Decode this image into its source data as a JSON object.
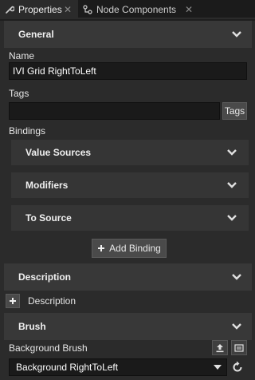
{
  "tabs": [
    {
      "label": "Properties",
      "icon": "wrench-icon",
      "active": true
    },
    {
      "label": "Node Components",
      "icon": "components-icon",
      "active": false
    }
  ],
  "tab_close_glyph": "✕",
  "general": {
    "title": "General",
    "name_label": "Name",
    "name_value": "IVI Grid RightToLeft",
    "tags_label": "Tags",
    "tags_value": "",
    "tags_button": "Tags",
    "bindings_label": "Bindings",
    "binding_sections": [
      "Value Sources",
      "Modifiers",
      "To Source"
    ],
    "add_binding_label": "Add Binding"
  },
  "description": {
    "title": "Description",
    "add_label": "Description"
  },
  "brush": {
    "title": "Brush",
    "background_brush_label": "Background Brush",
    "background_brush_value": "Background RightToLeft"
  },
  "colors": {
    "panel": "#2b2b2b",
    "header": "#383838",
    "field": "#1a1a1a",
    "text": "#e6e6e6"
  }
}
